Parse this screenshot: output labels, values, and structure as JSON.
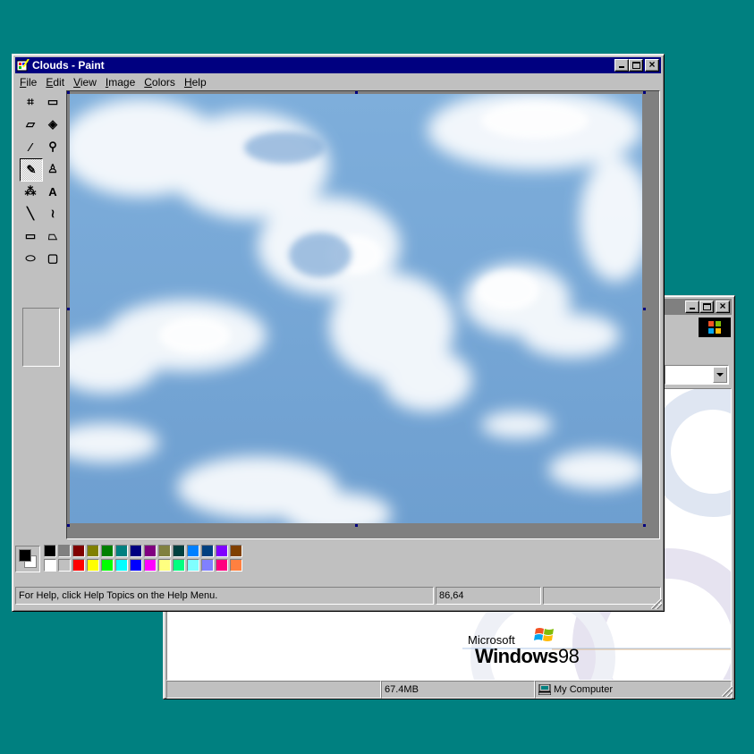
{
  "desktop": {
    "background_color": "#008080"
  },
  "back_window": {
    "status": {
      "size": "67.4MB",
      "location": "My Computer"
    },
    "logo": {
      "brand_line": "Microsoft",
      "product": "Windows",
      "version": "98"
    }
  },
  "paint_window": {
    "title": "Clouds - Paint",
    "menu": [
      "File",
      "Edit",
      "View",
      "Image",
      "Colors",
      "Help"
    ],
    "tools": [
      {
        "name": "free-form-select",
        "glyph": "⌗"
      },
      {
        "name": "select",
        "glyph": "▭"
      },
      {
        "name": "eraser",
        "glyph": "▱"
      },
      {
        "name": "fill",
        "glyph": "◈"
      },
      {
        "name": "pick-color",
        "glyph": "⁄"
      },
      {
        "name": "magnifier",
        "glyph": "⚲"
      },
      {
        "name": "pencil",
        "glyph": "✎",
        "active": true
      },
      {
        "name": "brush",
        "glyph": "♙"
      },
      {
        "name": "airbrush",
        "glyph": "⁂"
      },
      {
        "name": "text",
        "glyph": "A"
      },
      {
        "name": "line",
        "glyph": "╲"
      },
      {
        "name": "curve",
        "glyph": "≀"
      },
      {
        "name": "rectangle",
        "glyph": "▭"
      },
      {
        "name": "polygon",
        "glyph": "⏢"
      },
      {
        "name": "ellipse",
        "glyph": "⬭"
      },
      {
        "name": "rounded-rectangle",
        "glyph": "▢"
      }
    ],
    "palette": {
      "foreground": "#000000",
      "background": "#ffffff",
      "top_row": [
        "#000000",
        "#808080",
        "#800000",
        "#808000",
        "#008000",
        "#008080",
        "#000080",
        "#800080",
        "#808040",
        "#004040",
        "#0080ff",
        "#004080",
        "#8000ff",
        "#804000"
      ],
      "bottom_row": [
        "#ffffff",
        "#c0c0c0",
        "#ff0000",
        "#ffff00",
        "#00ff00",
        "#00ffff",
        "#0000ff",
        "#ff00ff",
        "#ffff80",
        "#00ff80",
        "#80ffff",
        "#8080ff",
        "#ff0080",
        "#ff8040"
      ]
    },
    "status": {
      "help_text": "For Help, click Help Topics on the Help Menu.",
      "coordinates": "86,64",
      "extra": ""
    }
  }
}
